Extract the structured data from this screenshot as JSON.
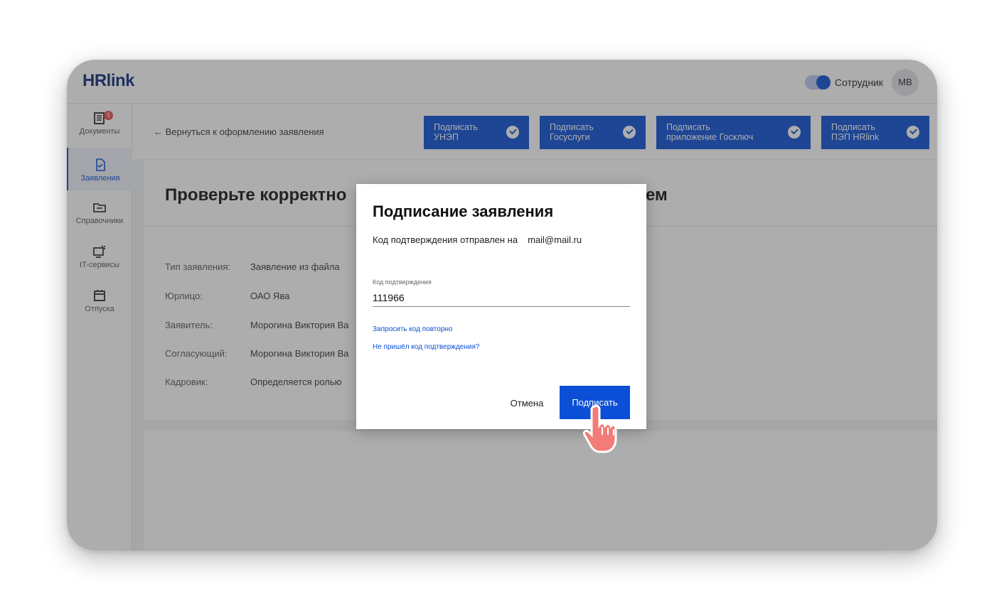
{
  "header": {
    "logo": "HRlink",
    "role_label": "Сотрудник",
    "avatar_initials": "МВ"
  },
  "sidebar": {
    "items": [
      {
        "label": "Документы",
        "icon": "document-list-icon",
        "badge": "5"
      },
      {
        "label": "Заявления",
        "icon": "file-check-icon"
      },
      {
        "label": "Справочники",
        "icon": "folder-icon"
      },
      {
        "label": "IT-сервисы",
        "icon": "it-services-icon"
      },
      {
        "label": "Отпуска",
        "icon": "calendar-icon"
      }
    ]
  },
  "subbar": {
    "back_link": "← Вернуться к оформлению заявления",
    "sign_buttons": [
      {
        "line1": "Подписать",
        "line2": "УНЭП"
      },
      {
        "line1": "Подписать",
        "line2": "Госуслуги"
      },
      {
        "line1": "Подписать",
        "line2": "приложение Госключ"
      },
      {
        "line1": "Подписать",
        "line2": "ПЭП HRlink"
      }
    ]
  },
  "content": {
    "title": "Проверьте корректно",
    "title_tail": "ем",
    "fields": [
      {
        "label": "Тип заявления:",
        "value": "Заявление из файла"
      },
      {
        "label": "Юрлицо:",
        "value": "ОАО Ява"
      },
      {
        "label": "Заявитель:",
        "value": "Морогина Виктория Ва"
      },
      {
        "label": "Согласующий:",
        "value": "Морогина Виктория Ва"
      },
      {
        "label": "Кадровик:",
        "value": "Определяется ролью"
      }
    ]
  },
  "modal": {
    "title": "Подписание заявления",
    "sent_text": "Код подтверждения отправлен на",
    "email": "mail@mail.ru",
    "code_label": "Код подтверждения",
    "code_value": "111966",
    "resend_link": "Запросить код повторно",
    "no_code_link": "Не пришёл код подтверждения?",
    "cancel_label": "Отмена",
    "submit_label": "Подписать"
  },
  "colors": {
    "accent": "#0a4fd6",
    "overlay": "rgba(60,60,60,0.42)"
  }
}
